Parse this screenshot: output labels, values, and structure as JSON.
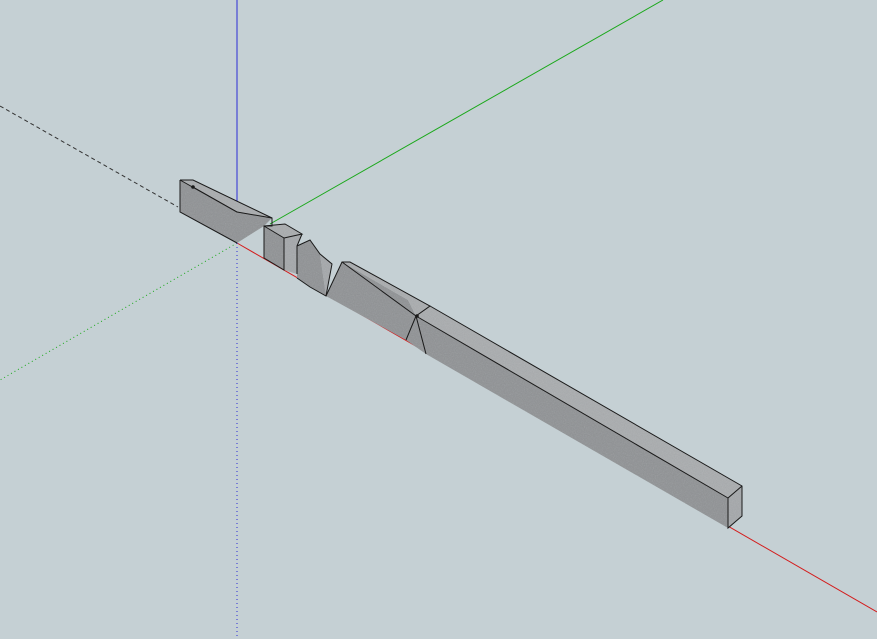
{
  "viewport": {
    "background": "#c5d0d4"
  },
  "axes": {
    "x_color": "#d41b1b",
    "y_color": "#1aa81a",
    "z_color": "#2b2bd6",
    "hidden_color": "#333333"
  },
  "model": {
    "face_top": "#a9acae",
    "face_front": "#8f9294",
    "face_side": "#a4a7aa",
    "edge": "#1a1a1a"
  }
}
